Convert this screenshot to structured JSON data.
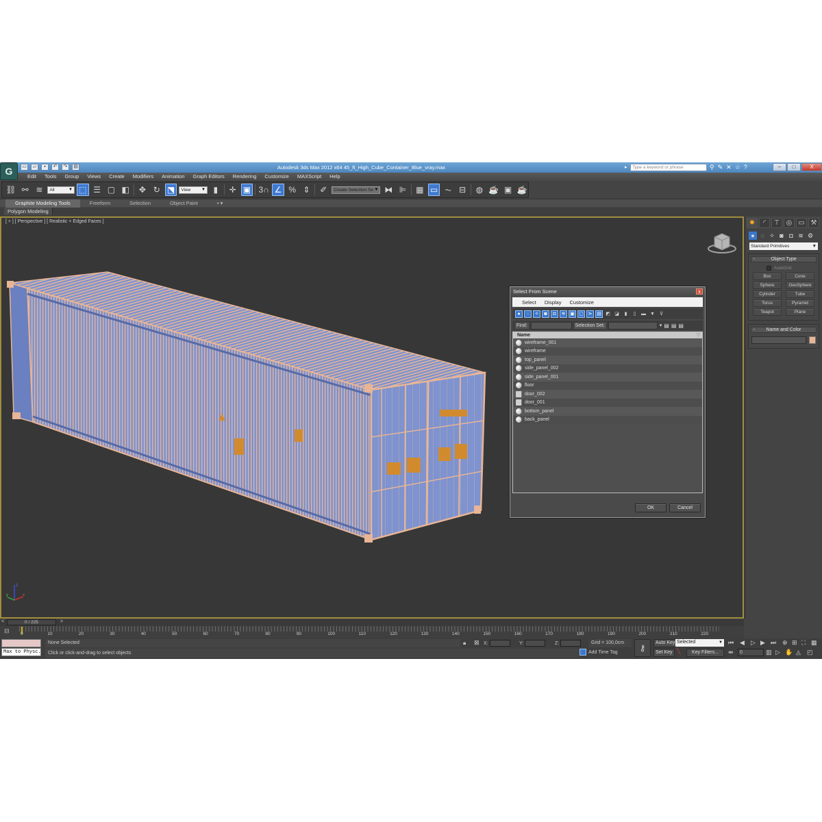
{
  "window": {
    "title": "Autodesk 3ds Max  2012 x64     45_ft_High_Cube_Container_Blue_vray.max",
    "search_placeholder": "Type a keyword or phrase",
    "buttons": {
      "minimize": "–",
      "maximize": "□",
      "close": "X"
    }
  },
  "menu": [
    "Edit",
    "Tools",
    "Group",
    "Views",
    "Create",
    "Modifiers",
    "Animation",
    "Graph Editors",
    "Rendering",
    "Customize",
    "MAXScript",
    "Help"
  ],
  "toolbar": {
    "selection_filter": "All",
    "reference_coord": "View",
    "named_selection_placeholder": "Create Selection Se",
    "snap_label": "3"
  },
  "ribbon": {
    "tabs": [
      "Graphite Modeling Tools",
      "Freeform",
      "Selection",
      "Object Paint"
    ],
    "active_tab": "Graphite Modeling Tools",
    "sub_panel": "Polygon Modeling"
  },
  "viewport": {
    "label": "[ + ] [ Perspective ] [ Realistic + Edged Faces ]",
    "object_colors": {
      "wire": "#e8b596",
      "body": "#7e93cf",
      "decal": "#d18b2e"
    }
  },
  "dialog": {
    "title": "Select From Scene",
    "menu": [
      "Select",
      "Display",
      "Customize"
    ],
    "find_label": "Find:",
    "selection_set_label": "Selection Set:",
    "column_header": "Name",
    "items": [
      {
        "name": "wireframe_001",
        "type": "geometry"
      },
      {
        "name": "wireframe",
        "type": "geometry"
      },
      {
        "name": "top_panel",
        "type": "geometry"
      },
      {
        "name": "side_panel_002",
        "type": "geometry"
      },
      {
        "name": "side_panel_001",
        "type": "geometry"
      },
      {
        "name": "floor",
        "type": "geometry"
      },
      {
        "name": "door_002",
        "type": "group"
      },
      {
        "name": "door_001",
        "type": "group"
      },
      {
        "name": "bottom_panel",
        "type": "geometry"
      },
      {
        "name": "back_panel",
        "type": "geometry"
      }
    ],
    "ok_label": "OK",
    "cancel_label": "Cancel"
  },
  "command_panel": {
    "category": "Standard Primitives",
    "object_type_title": "Object Type",
    "autogrid_label": "AutoGrid",
    "primitives": [
      "Box",
      "Cone",
      "Sphere",
      "GeoSphere",
      "Cylinder",
      "Tube",
      "Torus",
      "Pyramid",
      "Teapot",
      "Plane"
    ],
    "name_color_title": "Name and Color",
    "swatch_color": "#e8b596"
  },
  "timeline": {
    "frame_display": "0 / 225",
    "ticks": [
      "0",
      "10",
      "20",
      "30",
      "40",
      "50",
      "60",
      "70",
      "80",
      "90",
      "100",
      "110",
      "120",
      "130",
      "140",
      "150",
      "160",
      "170",
      "180",
      "190",
      "200",
      "210",
      "220"
    ],
    "max_frame": 225
  },
  "status": {
    "maxscript_listener": "Max to Physc.",
    "selection_status": "None Selected",
    "prompt": "Click or click-and-drag to select objects",
    "x_label": "X:",
    "y_label": "Y:",
    "z_label": "Z:",
    "grid": "Grid = 100,0cm",
    "add_time_tag": "Add Time Tag",
    "auto_key": "Auto Key",
    "set_key": "Set Key",
    "key_mode": "Selected",
    "key_filters": "Key Filters...",
    "current_frame": "0"
  }
}
